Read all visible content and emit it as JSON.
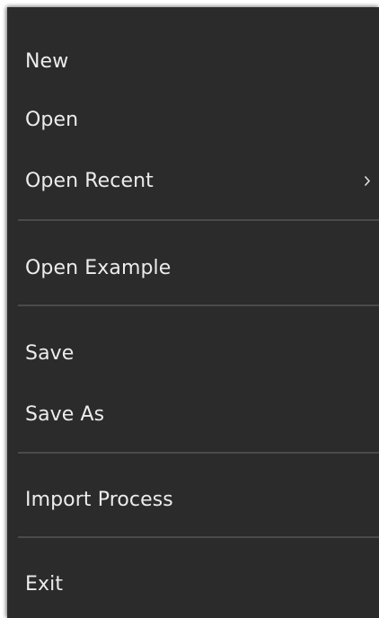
{
  "menu": {
    "items": {
      "new": {
        "label": "New"
      },
      "open": {
        "label": "Open"
      },
      "open_recent": {
        "label": "Open Recent",
        "submenu_icon": "chevron-right-icon"
      },
      "open_example": {
        "label": "Open Example"
      },
      "save": {
        "label": "Save"
      },
      "save_as": {
        "label": "Save As"
      },
      "import_process": {
        "label": "Import Process"
      },
      "exit": {
        "label": "Exit"
      }
    }
  },
  "colors": {
    "menu_background": "#2b2b2b",
    "text": "#ececec",
    "separator": "#4a4a4a"
  }
}
